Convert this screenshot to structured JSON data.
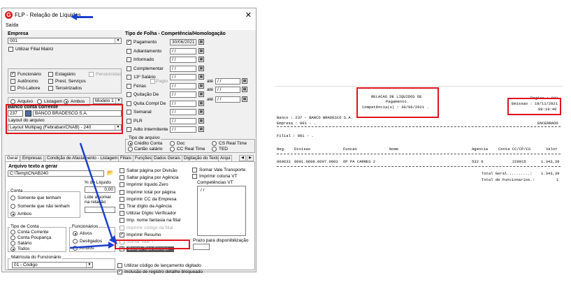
{
  "window": {
    "title": "FLP - Relação de Líquidos",
    "close": "✕",
    "menu": "Saída"
  },
  "empresa": {
    "title": "Empresa",
    "value": "001",
    "utilizar_filial": "Utilizar Filial Matriz",
    "types": [
      {
        "label": "Funcionário",
        "checked": true
      },
      {
        "label": "Estagiário",
        "checked": false
      },
      {
        "label": "Pensionistas",
        "checked": false
      },
      {
        "label": "Autônomo",
        "checked": false
      },
      {
        "label": "Prest. Serviços",
        "checked": false
      },
      {
        "label": "Pró-Labore",
        "checked": false
      },
      {
        "label": "Terceirizados",
        "checked": false
      }
    ],
    "output": [
      "Arquivo",
      "Listagem",
      "Ambos"
    ],
    "output_selected": "Ambos",
    "modelo": "Modelo 1"
  },
  "banco": {
    "title": "Banco conta corrente",
    "code": "237",
    "name": "BANCO BRADESCO S.A.",
    "layout_label": "Layout do arquivo",
    "layout_value": "Layout Multipag (Febraban/CNAB) - 240"
  },
  "folha": {
    "title": "Tipo de Folha - Competência/Homologação",
    "rows": [
      {
        "label": "Pagamento",
        "checked": true,
        "date": "30/06/2021"
      },
      {
        "label": "Adiantamento",
        "checked": false,
        "date": "/ /"
      },
      {
        "label": "Informado",
        "checked": false,
        "date": "/ /"
      },
      {
        "label": "Complementar",
        "checked": false,
        "date": "/ /"
      },
      {
        "label": "13º Salário",
        "checked": false,
        "date": "/ /"
      },
      {
        "label": "Férias",
        "checked": false,
        "date": "/ /"
      },
      {
        "label": "Quitação De",
        "checked": false,
        "date": "/ /"
      },
      {
        "label": "Quita.Compl De",
        "checked": false,
        "date": "/ /"
      },
      {
        "label": "Semanal",
        "checked": false,
        "date": "/ /"
      },
      {
        "label": "PLR",
        "checked": false,
        "date": "/ /"
      },
      {
        "label": "Adto Intermitente",
        "checked": false,
        "date": "/ /"
      }
    ],
    "ferias_pagto": "Pagto",
    "ate": "até",
    "ate_dates": [
      "/ /",
      "/ /",
      "/ /"
    ]
  },
  "tipo_arquivo": {
    "title": "Tipo de arquivo",
    "options": [
      "Crédito Conta",
      "Doc",
      "CS Real Time",
      "Cartão salário",
      "CC Real Time",
      "TED"
    ],
    "selected": "Crédito Conta"
  },
  "tabs": [
    "Geral",
    "Empresas",
    "Condição de Afastamento - Listagem",
    "Filiais",
    "Funções",
    "Dados Gerais",
    "Digitação do Texto",
    "Arqui"
  ],
  "geral": {
    "arquivo_title": "Arquivo texto a gerar",
    "arquivo_path": "C:\\Temp\\CNAB240",
    "pct_label": "% do Líquido",
    "pct_value": "0,00",
    "lote_label": "Lote a somar na relação",
    "conta_title": "Conta",
    "conta_options": [
      "Somente que tenham",
      "Somente que não tenham",
      "Ambos"
    ],
    "conta_selected": "Ambos",
    "tipo_conta_title": "Tipo de Conta",
    "tipo_conta_options": [
      "Conta Corrente",
      "Conta Poupança",
      "Salário",
      "Todos"
    ],
    "tipo_conta_selected": "Todos",
    "func_title": "Funcionários",
    "func_options": [
      "Ativos",
      "Desligados",
      "Ambos"
    ],
    "func_selected": "Ativos",
    "matricula_title": "Matrícula do Funcionário",
    "matricula_value": "01 - Código",
    "checks": [
      {
        "label": "Saltar página por Divisão",
        "checked": false
      },
      {
        "label": "Saltar página por Agência",
        "checked": false
      },
      {
        "label": "Imprimir líquido Zero",
        "checked": false
      },
      {
        "label": "Imprimir total por página",
        "checked": false
      },
      {
        "label": "Imprimir CC da Empresa",
        "checked": false
      },
      {
        "label": "Tirar dígito da Agência",
        "checked": false
      },
      {
        "label": "Utilizar Dígito Verificador",
        "checked": false
      },
      {
        "label": "Imp. nome fantasia na filial",
        "checked": false
      },
      {
        "label": "Imprimir código da filial",
        "checked": false
      },
      {
        "label": "Imprimir Resumo",
        "checked": true
      },
      {
        "label": "Somar Vale T.",
        "checked": false
      },
      {
        "label": "Compl. Tipo Serviço",
        "checked": true
      }
    ],
    "bottom_checks": [
      {
        "label": "Utilizar código de lançamento digitado",
        "checked": false
      },
      {
        "label": "Inclusão de registro detalhe bloqueado",
        "checked": true
      }
    ],
    "right_checks": [
      {
        "label": "Somar Vale Transporte",
        "checked": false
      },
      {
        "label": "Imprimir coluna VT",
        "checked": false
      }
    ],
    "competencias_title": "Competências VT",
    "competencias_value": "/ /",
    "prazo_label": "Prazo para disponibilização"
  },
  "report": {
    "title1": "RELACAO DE LIQUIDOS DE",
    "title2": "Pagamento.",
    "title3": "Competência(s) : 30/06/2021 .",
    "pagina": "Pagina : 001",
    "emissao": "Emissao : 19/11/2021",
    "hora": "09:19:40",
    "banco": "Banco : 237 - BANCO BRADESCO S.A.",
    "empresa": "Empresa : 001 - .",
    "encerrado": "ENCERRADO",
    "filial": "Filial : 001 - .",
    "headers": [
      "Reg.",
      "Divisao",
      "Funcao",
      "Nome",
      "Agencia",
      "Conta CC/CP/CS",
      "Valor"
    ],
    "row": [
      "000633",
      "0001.0608.0007.0003",
      "OP PA CARRES 2",
      "",
      "532 0",
      "228915",
      "1.343,39"
    ],
    "total_geral_label": "Total Geral..........:",
    "total_geral": "1.343,39",
    "total_func_label": "Total de Funcionarios.:",
    "total_func": "1"
  }
}
